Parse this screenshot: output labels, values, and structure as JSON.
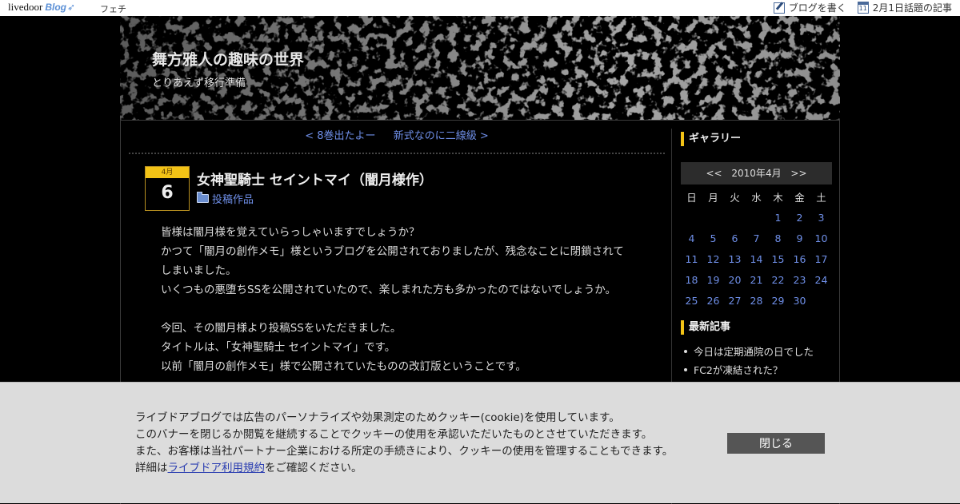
{
  "topbar": {
    "logo_text": "livedoor",
    "logo_blog": "Blog",
    "blog_link": "フェチ",
    "write_label": "ブログを書く",
    "calendar_icon_day": "11",
    "topic_label": "2月1日話題の記事"
  },
  "header": {
    "title": "舞方雅人の趣味の世界",
    "description": "とりあえず移行準備"
  },
  "pager": {
    "prev": "< 8巻出たよー",
    "next": "新式なのに二線級 >"
  },
  "post": {
    "month": "4月",
    "day": "6",
    "title": "女神聖騎士 セイントマイ（闇月様作）",
    "category": "投稿作品",
    "lines": [
      "皆様は闇月様を覚えていらっしゃいますでしょうか？",
      "かつて「闇月の創作メモ」様というブログを公開されておりましたが、残念なことに閉鎖されて",
      "しまいました。",
      "いくつもの悪堕ちSSを公開されていたので、楽しまれた方も多かったのではないでしょうか。",
      "",
      "今回、その闇月様より投稿SSをいただきました。",
      "タイトルは、「女神聖騎士 セイントマイ」です。",
      "以前「闇月の創作メモ」様で公開されていたものの改訂版ということです。"
    ]
  },
  "sidebar": {
    "gallery_heading": "ギャラリー",
    "calendar": {
      "prev": "<<",
      "month_label": "2010年4月",
      "next": ">>",
      "weekdays": [
        "日",
        "月",
        "火",
        "水",
        "木",
        "金",
        "土"
      ],
      "weeks": [
        [
          "",
          "",
          "",
          "",
          "1",
          "2",
          "3"
        ],
        [
          "4",
          "5",
          "6",
          "7",
          "8",
          "9",
          "10"
        ],
        [
          "11",
          "12",
          "13",
          "14",
          "15",
          "16",
          "17"
        ],
        [
          "18",
          "19",
          "20",
          "21",
          "22",
          "23",
          "24"
        ],
        [
          "25",
          "26",
          "27",
          "28",
          "29",
          "30",
          ""
        ]
      ]
    },
    "recent_heading": "最新記事",
    "recent": [
      "今日は定期通院の日でした",
      "FC2が凍結された？"
    ]
  },
  "cookie": {
    "line1": "ライブドアブログでは広告のパーソナライズや効果測定のためクッキー(cookie)を使用しています。",
    "line2": "このバナーを閉じるか閲覧を継続することでクッキーの使用を承認いただいたものとさせていただきます。",
    "line3": "また、お客様は当社パートナー企業における所定の手続きにより、クッキーの使用を管理することもできます。",
    "line4_prefix": "詳細は",
    "link_text": "ライブドア利用規約",
    "line4_suffix": "をご確認ください。",
    "close_label": "閉じる"
  },
  "colors": {
    "accent": "#f3c316",
    "link": "#6f8fe8",
    "background": "#000000",
    "banner": "#dcdcdc"
  }
}
